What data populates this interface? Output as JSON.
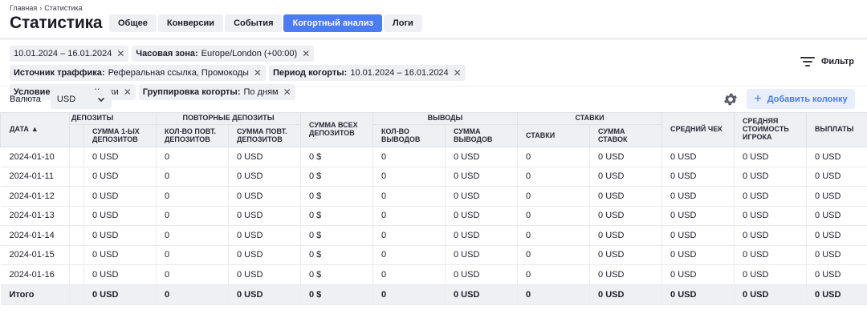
{
  "breadcrumb": {
    "home": "Главная",
    "separator": "›",
    "current": "Статистика"
  },
  "page_title": "Статистика",
  "tabs": [
    {
      "label": "Общее",
      "active": false
    },
    {
      "label": "Конверсии",
      "active": false
    },
    {
      "label": "События",
      "active": false
    },
    {
      "label": "Когортный анализ",
      "active": true
    },
    {
      "label": "Логи",
      "active": false
    }
  ],
  "filters": [
    {
      "key": "",
      "value": "10.01.2024 – 16.01.2024"
    },
    {
      "key": "Часовая зона:",
      "value": "Europe/London (+00:00)"
    },
    {
      "key": "Источник траффика:",
      "value": "Реферальная ссылка, Промокоды"
    },
    {
      "key": "Период когорты:",
      "value": "10.01.2024 – 16.01.2024"
    },
    {
      "key": "Условие когорты:",
      "value": "Клики"
    },
    {
      "key": "Группировка когорты:",
      "value": "По дням"
    }
  ],
  "filter_button": {
    "label": "Фильтр",
    "icon": "filter-icon"
  },
  "currency": {
    "label": "Валюта",
    "value": "USD"
  },
  "add_column": {
    "label": "Добавить колонку"
  },
  "accent_color": "#4a7cf5",
  "table": {
    "groups": {
      "deposits": "Депозиты",
      "repeat_deposits": "Повторные депозиты",
      "withdrawals": "Выводы",
      "bets": "Ставки"
    },
    "headers": {
      "date": "Дата",
      "first_dep_sum": "Сумма 1-ых депозитов",
      "repeat_count": "Кол-во повт. депозитов",
      "repeat_sum": "Сумма повт. депозитов",
      "all_dep_sum": "Сумма всех депозитов",
      "withdraw_count": "Кол-во выводов",
      "withdraw_sum": "Сумма выводов",
      "bets": "Ставки",
      "bets_sum": "Сумма ставок",
      "avg_check": "Средний чек",
      "avg_player_value": "Средняя стоимость игрока",
      "payouts": "Выплаты"
    },
    "rows": [
      [
        "2024-01-10",
        "0 USD",
        "0",
        "0 USD",
        "0 $",
        "0",
        "0 USD",
        "0",
        "0 USD",
        "0 USD",
        "0 USD",
        "0 USD"
      ],
      [
        "2024-01-11",
        "0 USD",
        "0",
        "0 USD",
        "0 $",
        "0",
        "0 USD",
        "0",
        "0 USD",
        "0 USD",
        "0 USD",
        "0 USD"
      ],
      [
        "2024-01-12",
        "0 USD",
        "0",
        "0 USD",
        "0 $",
        "0",
        "0 USD",
        "0",
        "0 USD",
        "0 USD",
        "0 USD",
        "0 USD"
      ],
      [
        "2024-01-13",
        "0 USD",
        "0",
        "0 USD",
        "0 $",
        "0",
        "0 USD",
        "0",
        "0 USD",
        "0 USD",
        "0 USD",
        "0 USD"
      ],
      [
        "2024-01-14",
        "0 USD",
        "0",
        "0 USD",
        "0 $",
        "0",
        "0 USD",
        "0",
        "0 USD",
        "0 USD",
        "0 USD",
        "0 USD"
      ],
      [
        "2024-01-15",
        "0 USD",
        "0",
        "0 USD",
        "0 $",
        "0",
        "0 USD",
        "0",
        "0 USD",
        "0 USD",
        "0 USD",
        "0 USD"
      ],
      [
        "2024-01-16",
        "0 USD",
        "0",
        "0 USD",
        "0 $",
        "0",
        "0 USD",
        "0",
        "0 USD",
        "0 USD",
        "0 USD",
        "0 USD"
      ]
    ],
    "total": [
      "Итого",
      "0 USD",
      "0",
      "0 USD",
      "0 $",
      "0",
      "0 USD",
      "0",
      "0 USD",
      "0 USD",
      "0 USD",
      "0 USD"
    ]
  }
}
